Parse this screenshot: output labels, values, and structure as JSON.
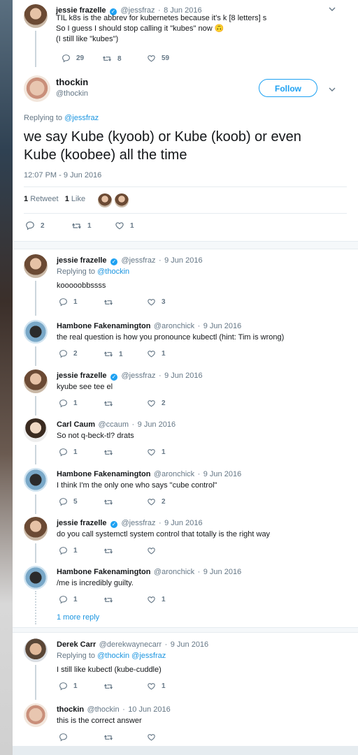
{
  "tweets": {
    "t1": {
      "name": "jessie frazelle",
      "handle": "@jessfraz",
      "date": "8 Jun 2016",
      "line1": "TIL k8s is the abbrev for kubernetes because it's k [8 letters] s",
      "line2": "So I guess I should stop calling it \"kubes\" now 🙃",
      "line3": "(I still like \"kubes\")",
      "replies": "29",
      "retweets": "8",
      "likes": "59"
    },
    "main": {
      "name": "thockin",
      "handle": "@thockin",
      "follow": "Follow",
      "replying_prefix": "Replying to",
      "replying_to": "@jessfraz",
      "line1": "we say Kube (kyoob) or Kube (koob) or even",
      "line2": "Kube (koobee) all the time",
      "timestamp": "12:07 PM - 9 Jun 2016",
      "retweet_count": "1",
      "retweet_label": "Retweet",
      "like_count": "1",
      "like_label": "Like",
      "replies": "2",
      "retweets": "1",
      "likes": "1"
    },
    "r1": {
      "name": "jessie frazelle",
      "handle": "@jessfraz",
      "date": "9 Jun 2016",
      "replying_prefix": "Replying to",
      "replying_to": "@thockin",
      "text": "kooooobbssss",
      "replies": "1",
      "retweets": "",
      "likes": "3"
    },
    "r2": {
      "name": "Hambone Fakenamington",
      "handle": "@aronchick",
      "date": "9 Jun 2016",
      "text": "the real question is how you pronounce kubectl (hint: Tim is wrong)",
      "replies": "2",
      "retweets": "1",
      "likes": "1"
    },
    "r3": {
      "name": "jessie frazelle",
      "handle": "@jessfraz",
      "date": "9 Jun 2016",
      "text": "kyube see tee el",
      "replies": "1",
      "retweets": "",
      "likes": "2"
    },
    "r4": {
      "name": "Carl Caum",
      "handle": "@ccaum",
      "date": "9 Jun 2016",
      "text": "So not q-beck-tl?  drats",
      "replies": "1",
      "retweets": "",
      "likes": "1"
    },
    "r5": {
      "name": "Hambone Fakenamington",
      "handle": "@aronchick",
      "date": "9 Jun 2016",
      "text": "I think I'm the only one who says \"cube control\"",
      "replies": "5",
      "retweets": "",
      "likes": "2"
    },
    "r6": {
      "name": "jessie frazelle",
      "handle": "@jessfraz",
      "date": "9 Jun 2016",
      "text": "do you call systemctl system control that totally is the right way",
      "replies": "1",
      "retweets": "",
      "likes": ""
    },
    "r7": {
      "name": "Hambone Fakenamington",
      "handle": "@aronchick",
      "date": "9 Jun 2016",
      "text": "/me is incredibly guilty.",
      "replies": "1",
      "retweets": "",
      "likes": "1"
    },
    "more_replies": "1 more reply",
    "r8": {
      "name": "Derek Carr",
      "handle": "@derekwaynecarr",
      "date": "9 Jun 2016",
      "replying_prefix": "Replying to",
      "replying_to": "@thockin @jessfraz",
      "text": "I still like kubectl (kube-cuddle)",
      "replies": "1",
      "retweets": "",
      "likes": "1"
    },
    "r9": {
      "name": "thockin",
      "handle": "@thockin",
      "date": "10 Jun 2016",
      "text": "this is the correct answer",
      "replies": "",
      "retweets": "",
      "likes": ""
    }
  },
  "separator": "·",
  "colors": {
    "blue": "#1da1f2",
    "link": "#1b95e0",
    "gray": "#657786",
    "line": "#ccd6dd"
  },
  "icons": [
    "reply-icon",
    "retweet-icon",
    "like-icon",
    "verified-icon",
    "chevron-down-icon"
  ]
}
